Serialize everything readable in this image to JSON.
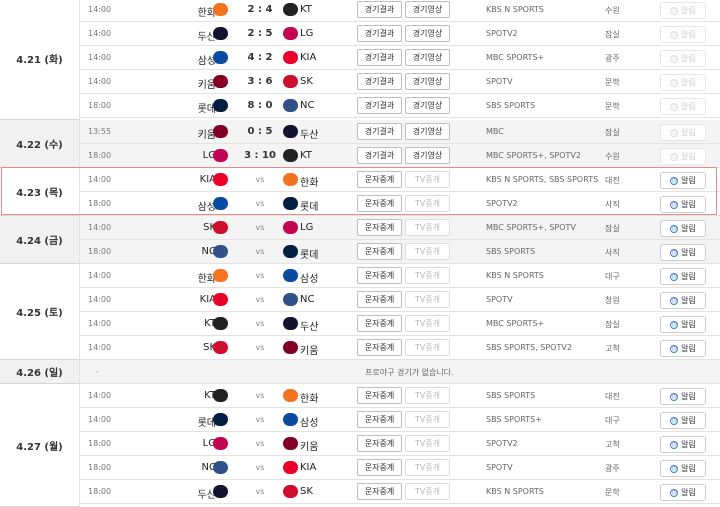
{
  "dates": [
    {
      "label": "4.21 (화)",
      "grey": false
    },
    {
      "label": "4.22 (수)",
      "grey": true
    },
    {
      "label": "4.23 (목)",
      "grey": false
    },
    {
      "label": "4.24 (금)",
      "grey": true
    },
    {
      "label": "4.25 (토)",
      "grey": false
    },
    {
      "label": "4.26 (일)",
      "grey": true
    },
    {
      "label": "4.27 (월)",
      "grey": false
    }
  ],
  "buttons": {
    "result": "경기결과",
    "video": "경기영상",
    "text": "문자중계",
    "tv": "TV중계",
    "alarm": "알림"
  },
  "vs_label": "vs",
  "no_game": {
    "dash": "-",
    "message": "프로야구 경기가 없습니다."
  },
  "games": [
    {
      "time": "14:00",
      "home": "한화",
      "away": "KT",
      "score": "2 : 4",
      "type": "result",
      "bc": "KBS N SPORTS",
      "stadium": "수원",
      "alarm": false
    },
    {
      "time": "14:00",
      "home": "두산",
      "away": "LG",
      "score": "2 : 5",
      "type": "result",
      "bc": "SPOTV2",
      "stadium": "잠실",
      "alarm": false
    },
    {
      "time": "14:00",
      "home": "삼성",
      "away": "KIA",
      "score": "4 : 2",
      "type": "result",
      "bc": "MBC SPORTS+",
      "stadium": "광주",
      "alarm": false
    },
    {
      "time": "14:00",
      "home": "키움",
      "away": "SK",
      "score": "3 : 6",
      "type": "result",
      "bc": "SPOTV",
      "stadium": "문학",
      "alarm": false
    },
    {
      "time": "18:00",
      "home": "롯데",
      "away": "NC",
      "score": "8 : 0",
      "type": "result",
      "bc": "SBS SPORTS",
      "stadium": "문학",
      "alarm": false
    },
    {
      "time": "13:55",
      "home": "키움",
      "away": "두산",
      "score": "0 : 5",
      "type": "result",
      "bc": "MBC",
      "stadium": "잠실",
      "alarm": false
    },
    {
      "time": "18:00",
      "home": "LG",
      "away": "KT",
      "score": "3 : 10",
      "type": "result",
      "bc": "MBC SPORTS+, SPOTV2",
      "stadium": "수원",
      "alarm": false
    },
    {
      "time": "14:00",
      "home": "KIA",
      "away": "한화",
      "score": "",
      "type": "live",
      "bc": "KBS N SPORTS, SBS SPORTS",
      "stadium": "대전",
      "alarm": true
    },
    {
      "time": "18:00",
      "home": "삼성",
      "away": "롯데",
      "score": "",
      "type": "live",
      "bc": "SPOTV2",
      "stadium": "사직",
      "alarm": true
    },
    {
      "time": "14:00",
      "home": "SK",
      "away": "LG",
      "score": "",
      "type": "live",
      "bc": "MBC SPORTS+, SPOTV",
      "stadium": "잠실",
      "alarm": true
    },
    {
      "time": "18:00",
      "home": "NC",
      "away": "롯데",
      "score": "",
      "type": "live",
      "bc": "SBS SPORTS",
      "stadium": "사직",
      "alarm": true
    },
    {
      "time": "14:00",
      "home": "한화",
      "away": "삼성",
      "score": "",
      "type": "live",
      "bc": "KBS N SPORTS",
      "stadium": "대구",
      "alarm": true
    },
    {
      "time": "14:00",
      "home": "KIA",
      "away": "NC",
      "score": "",
      "type": "live",
      "bc": "SPOTV",
      "stadium": "창원",
      "alarm": true
    },
    {
      "time": "14:00",
      "home": "KT",
      "away": "두산",
      "score": "",
      "type": "live",
      "bc": "MBC SPORTS+",
      "stadium": "잠실",
      "alarm": true
    },
    {
      "time": "14:00",
      "home": "SK",
      "away": "키움",
      "score": "",
      "type": "live",
      "bc": "SBS SPORTS, SPOTV2",
      "stadium": "고척",
      "alarm": true
    },
    {
      "time": "14:00",
      "home": "KT",
      "away": "한화",
      "score": "",
      "type": "live",
      "bc": "SBS SPORTS",
      "stadium": "대전",
      "alarm": true
    },
    {
      "time": "14:00",
      "home": "롯데",
      "away": "삼성",
      "score": "",
      "type": "live",
      "bc": "SBS SPORTS+",
      "stadium": "대구",
      "alarm": true
    },
    {
      "time": "18:00",
      "home": "LG",
      "away": "키움",
      "score": "",
      "type": "live",
      "bc": "SPOTV2",
      "stadium": "고척",
      "alarm": true
    },
    {
      "time": "18:00",
      "home": "NC",
      "away": "KIA",
      "score": "",
      "type": "live",
      "bc": "SPOTV",
      "stadium": "광주",
      "alarm": true
    },
    {
      "time": "18:00",
      "home": "두산",
      "away": "SK",
      "score": "",
      "type": "live",
      "bc": "KBS N SPORTS",
      "stadium": "문학",
      "alarm": true
    }
  ],
  "team_colors": {
    "한화": "#f37321",
    "KT": "#222222",
    "두산": "#131230",
    "LG": "#c30452",
    "삼성": "#074ca1",
    "KIA": "#ea0029",
    "키움": "#820024",
    "SK": "#ce0e2d",
    "롯데": "#041e42",
    "NC": "#315288"
  }
}
